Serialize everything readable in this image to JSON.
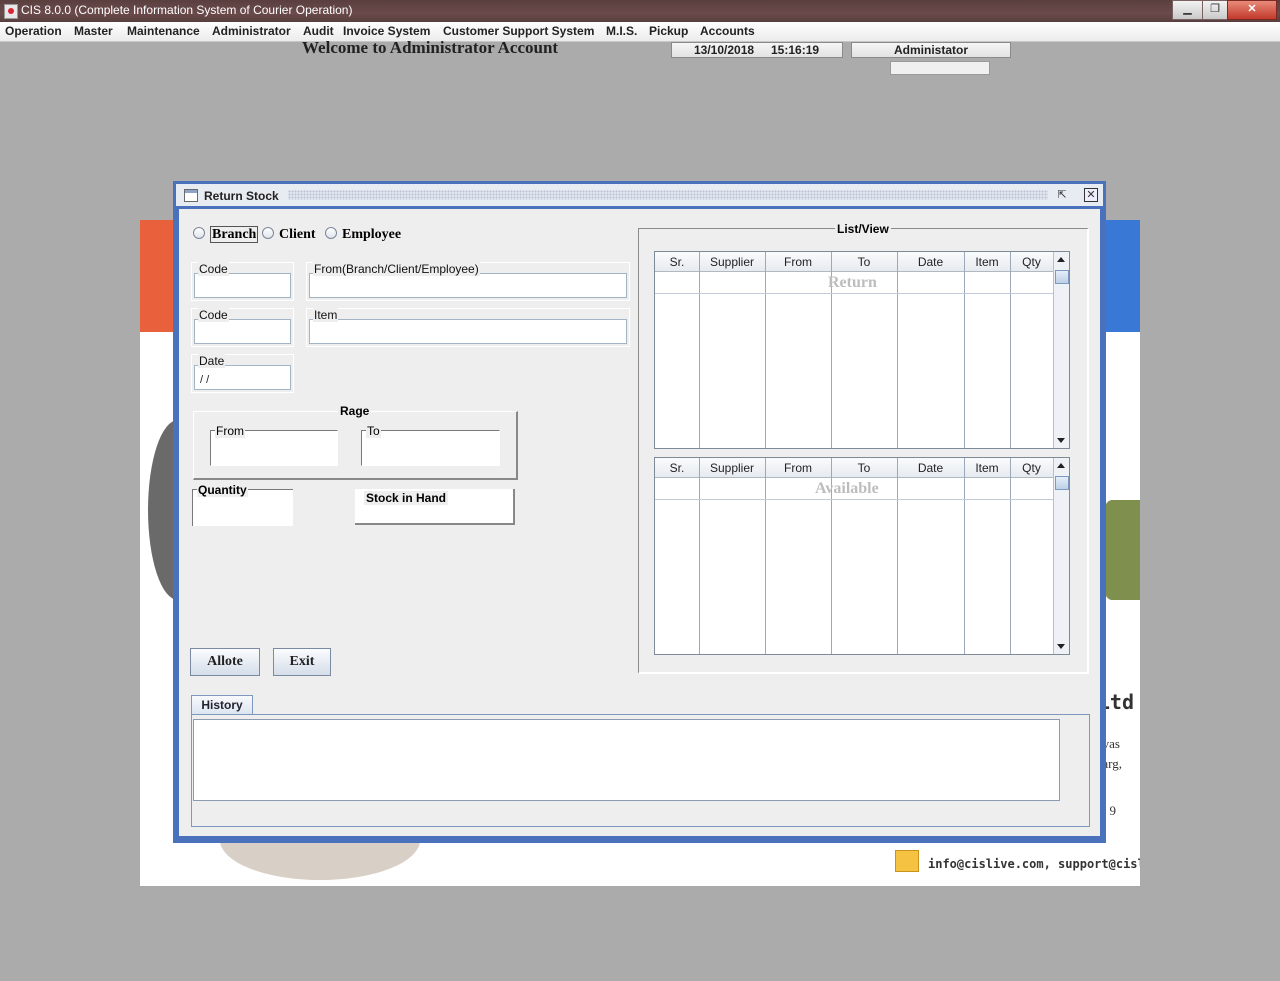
{
  "window": {
    "title": "CIS 8.0.0 (Complete Information System of Courier Operation)",
    "minimize_label": "▁",
    "restore_label": "❐",
    "close_label": "✕"
  },
  "menu": [
    "Operation",
    "Master",
    "Maintenance",
    "Administrator",
    "Audit",
    "Invoice System",
    "Customer Support System",
    "M.I.S.",
    "Pickup",
    "Accounts"
  ],
  "header": {
    "welcome": "Welcome to Administrator Account",
    "date": "13/10/2018",
    "time": "15:16:19",
    "user": "Administator"
  },
  "background": {
    "ltd": "Ltd",
    "line_as": "vas",
    "line_arg": "arg,",
    "line_nine": "9",
    "emails": "info@cislive.com, support@cislive.com"
  },
  "dialog": {
    "title": "Return Stock",
    "max_label": "⇱",
    "close_label": "✕",
    "radios": [
      {
        "label": "Branch",
        "selected": true
      },
      {
        "label": "Client",
        "selected": false
      },
      {
        "label": "Employee",
        "selected": false
      }
    ],
    "fields": {
      "code1": "Code",
      "from_entity": "From(Branch/Client/Employee)",
      "code2": "Code",
      "item": "Item",
      "date": "Date",
      "date_value": " /  /",
      "rage": "Rage",
      "rage_from": "From",
      "rage_to": "To",
      "quantity": "Quantity",
      "stock_in_hand": "Stock in Hand"
    },
    "buttons": {
      "allote": "Allote",
      "exit": "Exit"
    },
    "list_view": {
      "title": "List/View",
      "columns": [
        "Sr.",
        "Supplier",
        "From",
        "To",
        "Date",
        "Item",
        "Qty"
      ],
      "return_watermark": "Return",
      "available_watermark": "Available"
    },
    "history_tab": "History"
  }
}
